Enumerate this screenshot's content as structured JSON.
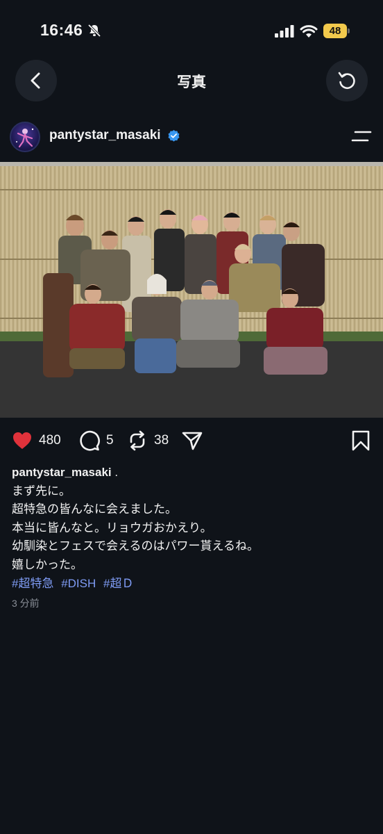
{
  "status_bar": {
    "time": "16:46",
    "battery": "48"
  },
  "header": {
    "title": "写真"
  },
  "post": {
    "username": "pantystar_masaki",
    "likes": "480",
    "comments": "5",
    "reposts": "38",
    "caption_user": "pantystar_masaki",
    "caption_after_user": ".",
    "caption_lines": [
      "まず先に。",
      "超特急の皆んなに会えました。",
      "本当に皆んなと。リョウガおかえり。",
      "幼馴染とフェスで会えるのはパワー貰えるね。",
      "嬉しかった。"
    ],
    "hashtags": [
      "#超特急",
      "#DISH",
      "#超Ｄ"
    ],
    "time_ago": "3 分前"
  },
  "icons": {
    "like": "heart-icon",
    "comment": "comment-icon",
    "repost": "repost-icon",
    "share": "send-icon",
    "bookmark": "bookmark-icon"
  },
  "colors": {
    "like_red": "#e0323b",
    "hashtag_blue": "#7f9cf5",
    "verified_blue": "#3897f0"
  }
}
